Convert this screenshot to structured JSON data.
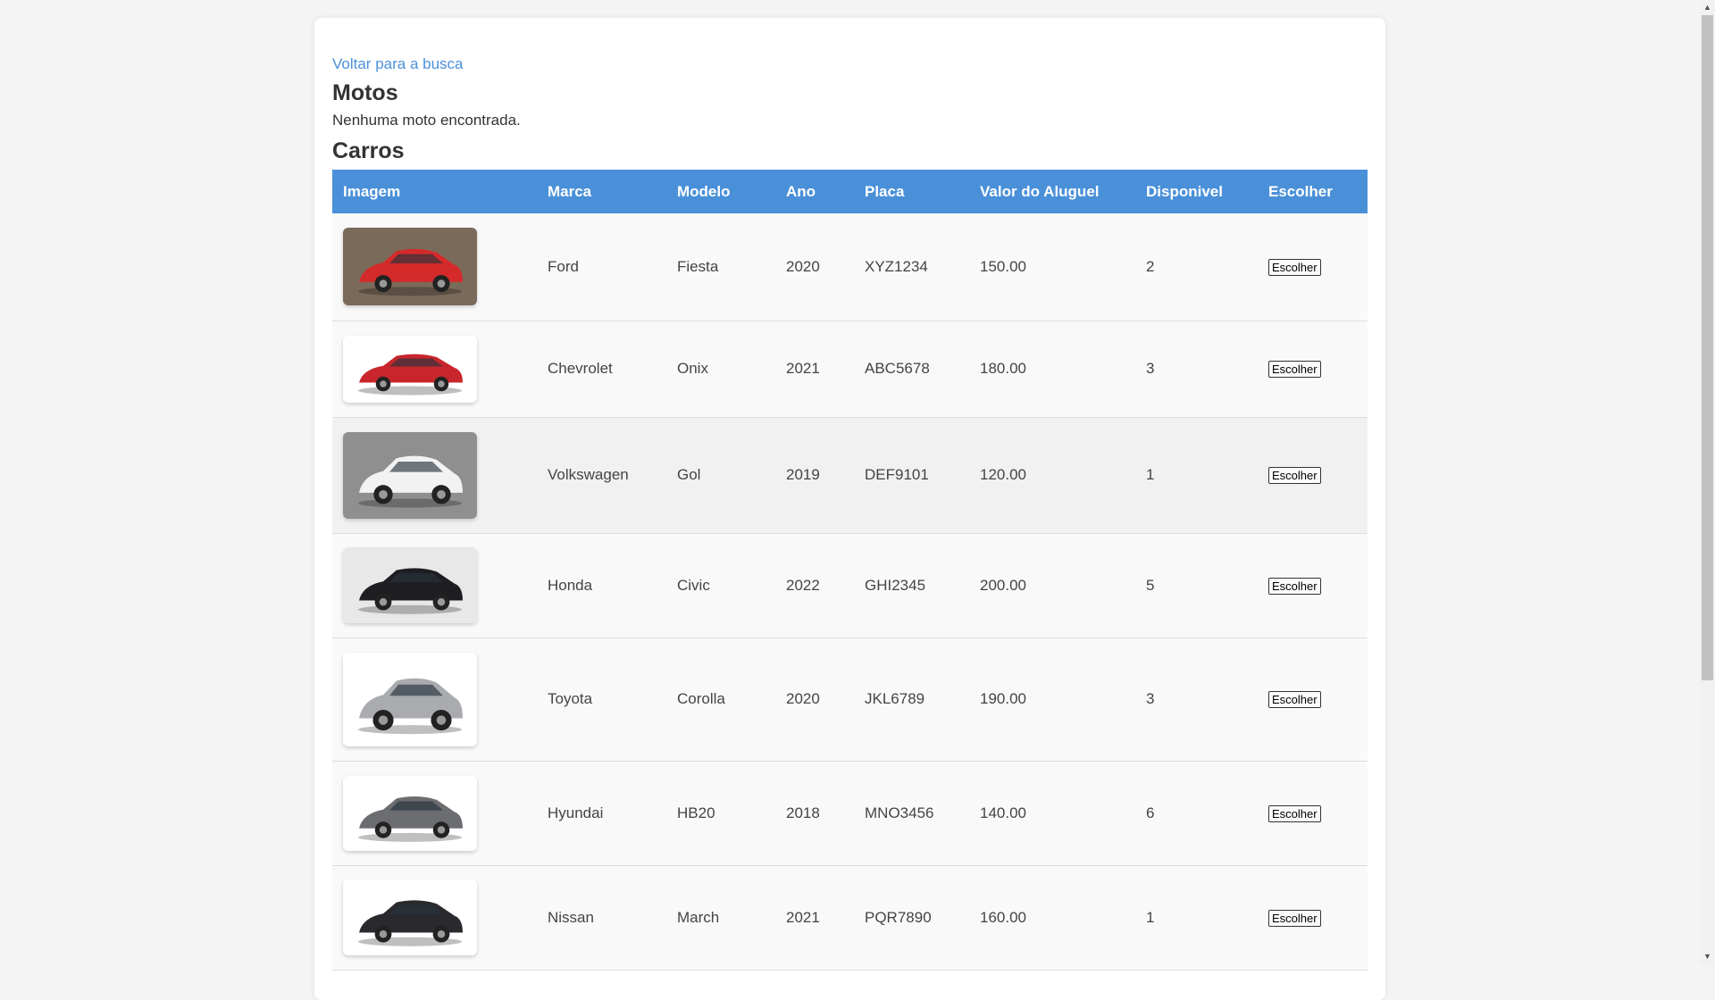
{
  "back_link": "Voltar para a busca",
  "motos": {
    "heading": "Motos",
    "empty_message": "Nenhuma moto encontrada."
  },
  "carros": {
    "heading": "Carros",
    "columns": [
      "Imagem",
      "Marca",
      "Modelo",
      "Ano",
      "Placa",
      "Valor do Aluguel",
      "Disponivel",
      "Escolher"
    ],
    "rows": [
      {
        "marca": "Ford",
        "modelo": "Fiesta",
        "ano": "2020",
        "placa": "XYZ1234",
        "valor": "150.00",
        "disponivel": "2",
        "button": "Escolher",
        "car_color": "#d42a2a",
        "bg_color": "#7a6a5a"
      },
      {
        "marca": "Chevrolet",
        "modelo": "Onix",
        "ano": "2021",
        "placa": "ABC5678",
        "valor": "180.00",
        "disponivel": "3",
        "button": "Escolher",
        "car_color": "#c8262c",
        "bg_color": "#ffffff"
      },
      {
        "marca": "Volkswagen",
        "modelo": "Gol",
        "ano": "2019",
        "placa": "DEF9101",
        "valor": "120.00",
        "disponivel": "1",
        "button": "Escolher",
        "car_color": "#f2f2f2",
        "bg_color": "#8f8f8f"
      },
      {
        "marca": "Honda",
        "modelo": "Civic",
        "ano": "2022",
        "placa": "GHI2345",
        "valor": "200.00",
        "disponivel": "5",
        "button": "Escolher",
        "car_color": "#1e1e22",
        "bg_color": "#e8e8e8"
      },
      {
        "marca": "Toyota",
        "modelo": "Corolla",
        "ano": "2020",
        "placa": "JKL6789",
        "valor": "190.00",
        "disponivel": "3",
        "button": "Escolher",
        "car_color": "#a9abae",
        "bg_color": "#ffffff"
      },
      {
        "marca": "Hyundai",
        "modelo": "HB20",
        "ano": "2018",
        "placa": "MNO3456",
        "valor": "140.00",
        "disponivel": "6",
        "button": "Escolher",
        "car_color": "#6b6d70",
        "bg_color": "#ffffff"
      },
      {
        "marca": "Nissan",
        "modelo": "March",
        "ano": "2021",
        "placa": "PQR7890",
        "valor": "160.00",
        "disponivel": "1",
        "button": "Escolher",
        "car_color": "#2a2a2e",
        "bg_color": "#ffffff"
      }
    ]
  },
  "colors": {
    "accent": "#4a90d9",
    "link": "#4a90d9",
    "page_bg": "#f4f4f4"
  }
}
